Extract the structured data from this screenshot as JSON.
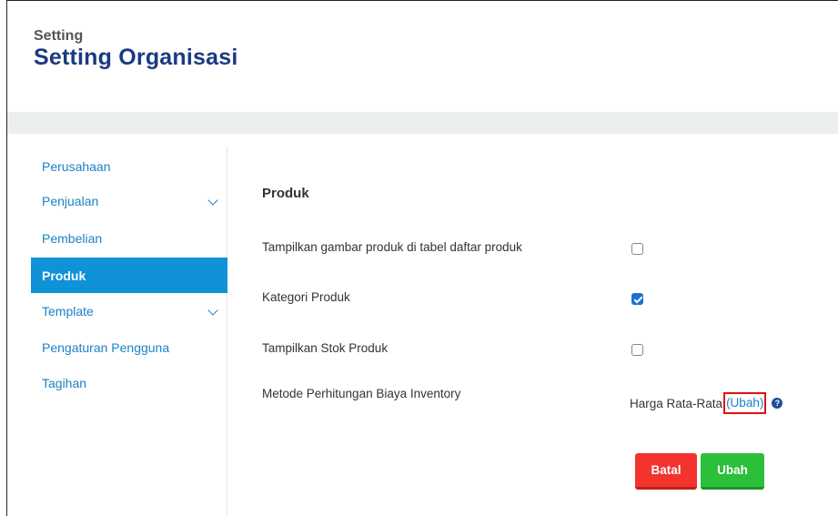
{
  "header": {
    "breadcrumb": "Setting",
    "title": "Setting Organisasi"
  },
  "sidebar": {
    "items": [
      {
        "label": "Perusahaan",
        "has_chevron": false,
        "active": false
      },
      {
        "label": "Penjualan",
        "has_chevron": true,
        "active": false
      },
      {
        "label": "Pembelian",
        "has_chevron": false,
        "active": false
      },
      {
        "label": "Produk",
        "has_chevron": false,
        "active": true
      },
      {
        "label": "Template",
        "has_chevron": true,
        "active": false
      },
      {
        "label": "Pengaturan Pengguna",
        "has_chevron": false,
        "active": false
      },
      {
        "label": "Tagihan",
        "has_chevron": false,
        "active": false
      }
    ]
  },
  "main": {
    "section_title": "Produk",
    "settings": [
      {
        "label": "Tampilkan gambar produk di tabel daftar produk",
        "checked": false
      },
      {
        "label": "Kategori Produk",
        "checked": true
      },
      {
        "label": "Tampilkan Stok Produk",
        "checked": false
      }
    ],
    "inventory": {
      "label": "Metode Perhitungan Biaya Inventory",
      "value": "Harga Rata-Rata",
      "change_link": "(Ubah)",
      "help_icon": "question-circle-icon"
    },
    "buttons": {
      "cancel": "Batal",
      "save": "Ubah"
    }
  },
  "colors": {
    "brand_title": "#1a3a82",
    "link": "#1a82c4",
    "active_nav": "#0f92d8",
    "cancel": "#f2332e",
    "save": "#2cbf3a",
    "highlight_box": "#e01010"
  }
}
